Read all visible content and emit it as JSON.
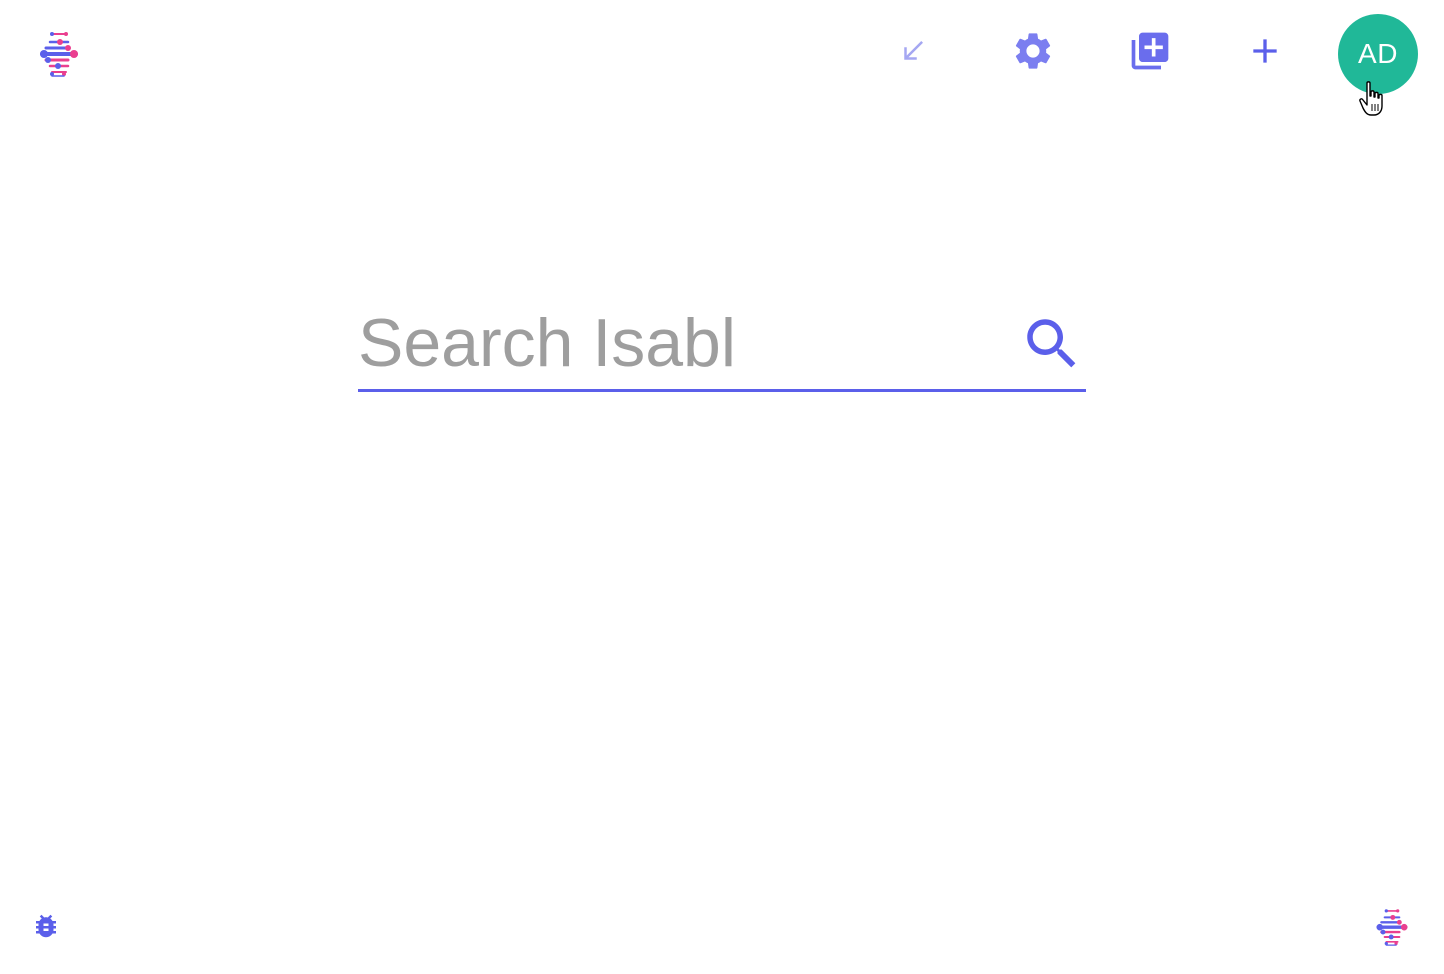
{
  "colors": {
    "accent": "#5b5fea",
    "accent_light": "#a5a7f2",
    "settings_icon": "#7b7ef0",
    "avatar_bg": "#20b898",
    "logo_blue": "#5b5fea",
    "logo_pink": "#ea3f8f",
    "placeholder": "#9e9e9e"
  },
  "header": {
    "logo_icon": "isabl-logo",
    "collapse_icon": "arrow-south-west-icon",
    "settings_icon": "gear-icon",
    "add_library_icon": "library-add-icon",
    "add_icon": "plus-icon",
    "avatar_initials": "AD"
  },
  "search": {
    "placeholder": "Search Isabl",
    "value": "",
    "search_icon": "search-icon"
  },
  "footer": {
    "bug_icon": "bug-report-icon",
    "logo_icon": "isabl-logo"
  }
}
